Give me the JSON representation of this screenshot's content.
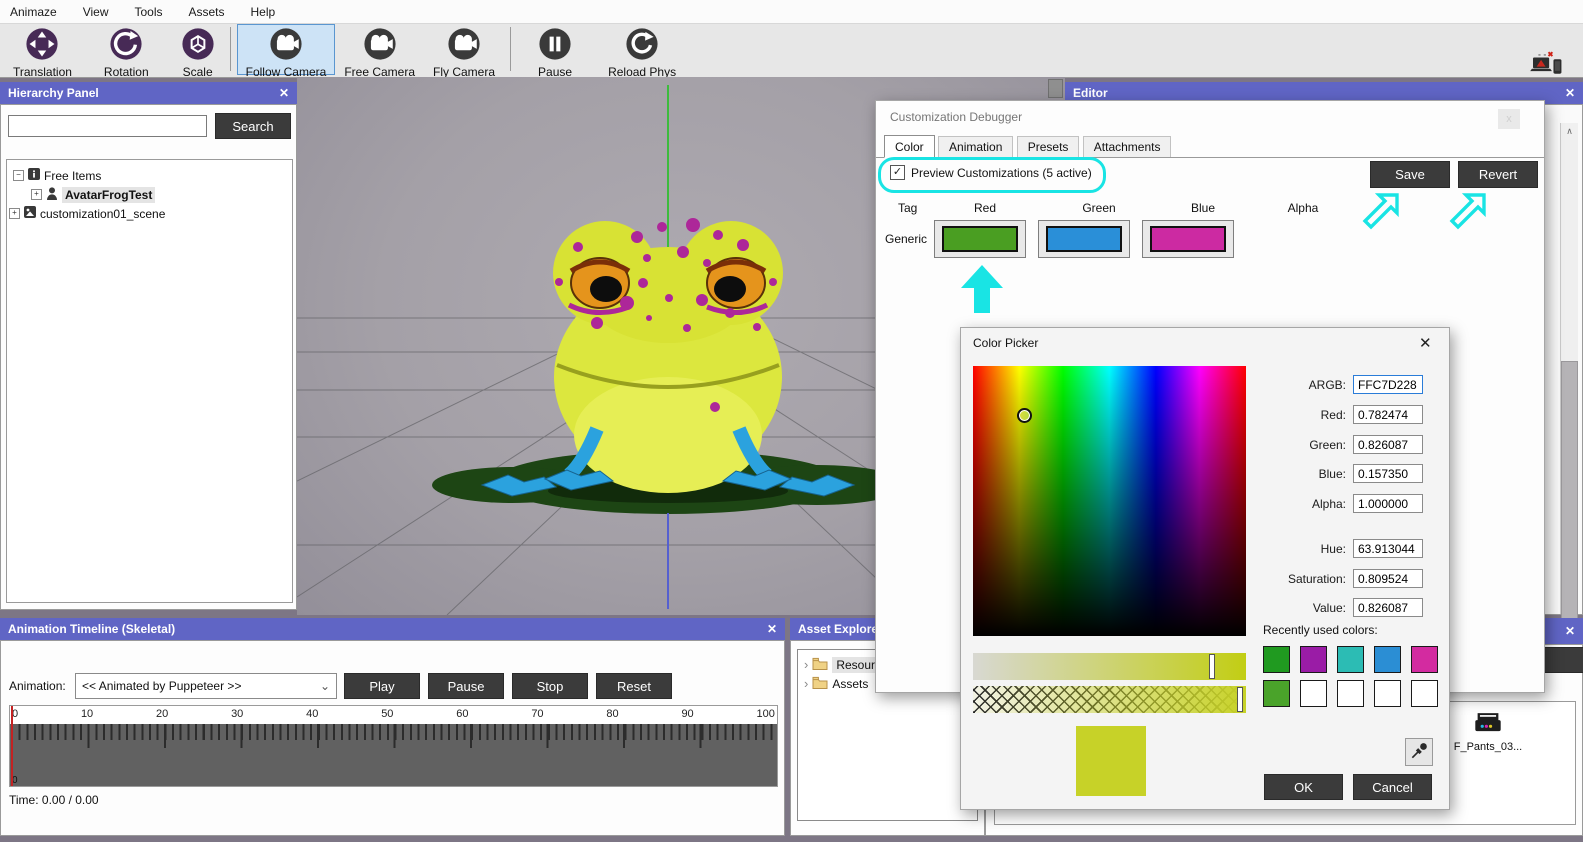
{
  "icons": {
    "close": "✕",
    "dialog_close": "x",
    "chevron_down": "⌄",
    "scroll_up": "∧",
    "tree_collapse": "−",
    "tree_expand": "+",
    "chevron_right": "›",
    "check": "✓"
  },
  "menu": {
    "items": [
      "Animaze",
      "View",
      "Tools",
      "Assets",
      "Help"
    ]
  },
  "toolbar": {
    "translation": "Translation",
    "rotation": "Rotation",
    "scale": "Scale",
    "follow_camera": "Follow Camera",
    "free_camera": "Free Camera",
    "fly_camera": "Fly Camera",
    "pause": "Pause",
    "reload_phys": "Reload Phys",
    "connect": "Connect"
  },
  "hierarchy": {
    "title": "Hierarchy Panel",
    "search_button": "Search",
    "items": [
      {
        "label": "Free Items"
      },
      {
        "label": "AvatarFrogTest"
      },
      {
        "label": "customization01_scene"
      }
    ]
  },
  "editor": {
    "title": "Editor"
  },
  "debugger": {
    "title": "Customization Debugger",
    "tabs": [
      "Color",
      "Animation",
      "Presets",
      "Attachments"
    ],
    "preview_checkbox": "Preview Customizations (5 active)",
    "save": "Save",
    "revert": "Revert",
    "columns": [
      "Tag",
      "Red",
      "Green",
      "Blue",
      "Alpha"
    ],
    "row_label": "Generic",
    "swatch_colors": [
      "#4a9e22",
      "#2a8fd8",
      "#cc2aa2"
    ]
  },
  "color_picker": {
    "title": "Color Picker",
    "fields": [
      {
        "label": "ARGB:",
        "value": "FFC7D228"
      },
      {
        "label": "Red:",
        "value": "0.782474"
      },
      {
        "label": "Green:",
        "value": "0.826087"
      },
      {
        "label": "Blue:",
        "value": "0.157350"
      },
      {
        "label": "Alpha:",
        "value": "1.000000"
      },
      {
        "label": "Hue:",
        "value": "63.913044"
      },
      {
        "label": "Saturation:",
        "value": "0.809524"
      },
      {
        "label": "Value:",
        "value": "0.826087"
      }
    ],
    "recent_label": "Recently used colors:",
    "recent_colors": [
      "#209a20",
      "#9a1ca6",
      "#2cbcb4",
      "#2b8ed4",
      "#d32ba0",
      "#4aa32a",
      "#ffffff",
      "#ffffff",
      "#ffffff",
      "#ffffff"
    ],
    "current_color": "#c7d228",
    "ok": "OK",
    "cancel": "Cancel"
  },
  "timeline": {
    "title": "Animation Timeline (Skeletal)",
    "animation_label": "Animation:",
    "dropdown_value": "<< Animated by Puppeteer >>",
    "play": "Play",
    "pause": "Pause",
    "stop": "Stop",
    "reset": "Reset",
    "ruler_labels": [
      "0",
      "10",
      "20",
      "30",
      "40",
      "50",
      "60",
      "70",
      "80",
      "90",
      "100"
    ],
    "start_label": "0",
    "time_label": "Time: 0.00 / 0.00"
  },
  "asset_explorer": {
    "title": "Asset Explorer",
    "items": [
      {
        "label": "Resources"
      },
      {
        "label": "Assets"
      }
    ]
  },
  "bottom_right": {
    "file_label": "F_Pants_03..."
  }
}
